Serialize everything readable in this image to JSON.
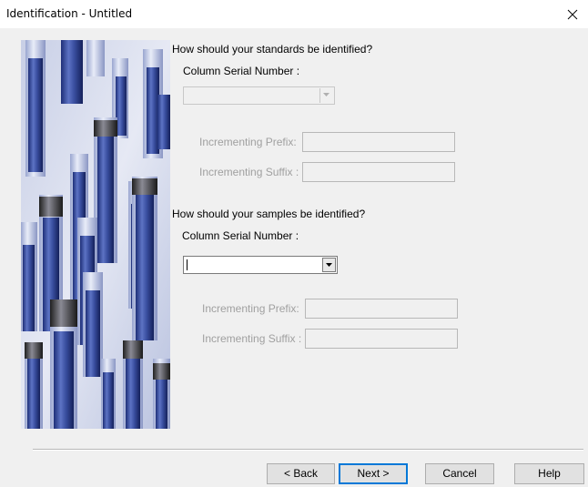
{
  "window": {
    "title": "Identification - Untitled"
  },
  "standards": {
    "question": "How should your standards be identified?",
    "column_serial_label": "Column Serial Number :",
    "column_serial_value": "",
    "prefix_label": "Incrementing Prefix:",
    "prefix_value": "",
    "suffix_label": "Incrementing Suffix :",
    "suffix_value": ""
  },
  "samples": {
    "question": "How should your samples be identified?",
    "column_serial_label": "Column Serial Number :",
    "column_serial_value": "",
    "prefix_label": "Incrementing Prefix:",
    "prefix_value": "",
    "suffix_label": "Incrementing Suffix :",
    "suffix_value": ""
  },
  "buttons": {
    "back": "< Back",
    "next": "Next >",
    "cancel": "Cancel",
    "help": "Help"
  },
  "icons": {
    "close": "close-icon",
    "dropdown": "chevron-down-icon"
  },
  "colors": {
    "focus_border": "#0078d7",
    "dialog_bg": "#f0f0f0",
    "vial_blue": "#4a5fa8"
  }
}
